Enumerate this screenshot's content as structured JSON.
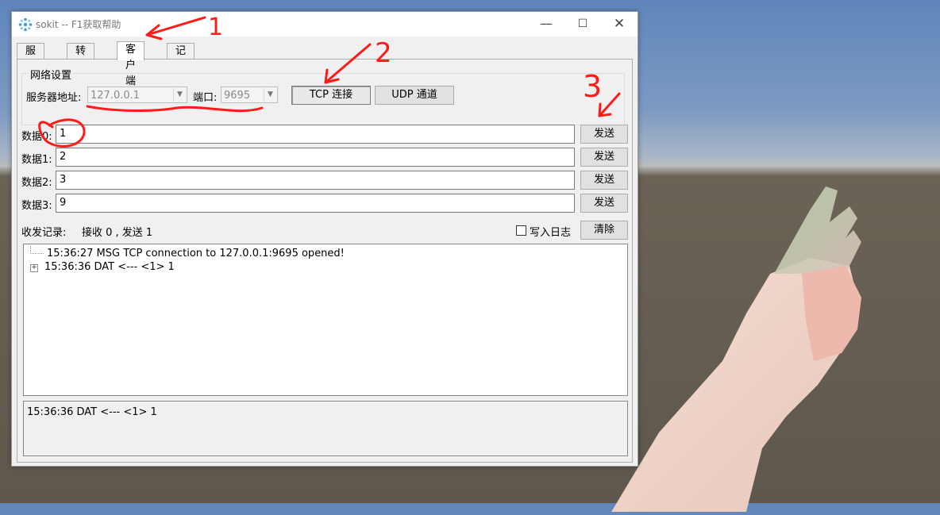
{
  "window": {
    "title": "sokit -- F1获取帮助",
    "min_glyph": "—",
    "max_glyph": "☐",
    "close_glyph": "✕"
  },
  "tabs": [
    {
      "label": "服务器"
    },
    {
      "label": "转发器"
    },
    {
      "label": "客户端",
      "active": true
    },
    {
      "label": "记事板"
    }
  ],
  "network": {
    "group_title": "网络设置",
    "server_label": "服务器地址:",
    "server_value": "127.0.0.1",
    "port_label": "端口:",
    "port_value": "9695",
    "tcp_button": "TCP 连接",
    "udp_button": "UDP 通道"
  },
  "data_rows": [
    {
      "label": "数据0:",
      "value": "1",
      "send": "发送"
    },
    {
      "label": "数据1:",
      "value": "2",
      "send": "发送"
    },
    {
      "label": "数据2:",
      "value": "3",
      "send": "发送"
    },
    {
      "label": "数据3:",
      "value": "9",
      "send": "发送"
    }
  ],
  "log": {
    "record_label": "收发记录:",
    "stats": "接收 0 , 发送 1",
    "write_log_label": "写入日志",
    "write_log_checked": false,
    "clear_button": "清除",
    "entries": [
      "15:36:27 MSG TCP connection to 127.0.0.1:9695 opened!",
      "15:36:36 DAT <--- <1> 1"
    ],
    "detail": "15:36:36 DAT <--- <1> 1"
  },
  "annotations": {
    "mark1": "1",
    "mark2": "2",
    "mark3": "3",
    "ink_color": "#ff1a1a"
  },
  "colors": {
    "sky": "#6b8fc0",
    "ground": "#5e574d",
    "window_bg": "#f0f0f0"
  }
}
